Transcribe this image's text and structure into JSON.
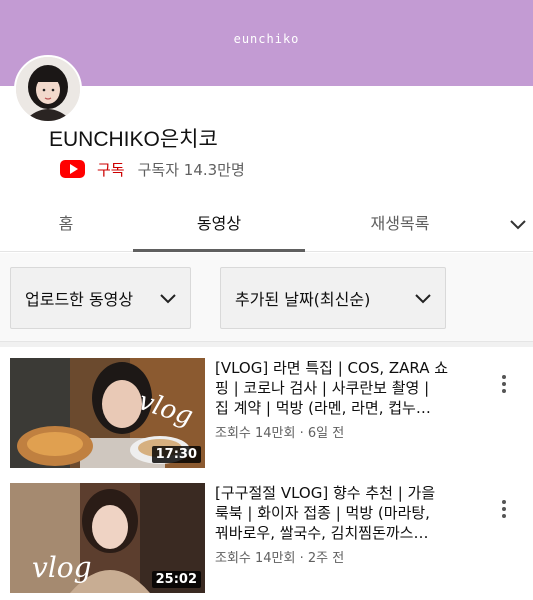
{
  "banner": {
    "text": "eunchiko",
    "color": "#c39bd3"
  },
  "channel": {
    "name": "EUNCHIKO은치코",
    "subscribe_label": "구독",
    "subscriber_count": "구독자 14.3만명"
  },
  "tabs": [
    {
      "label": "홈"
    },
    {
      "label": "동영상",
      "selected": true
    },
    {
      "label": "재생목록"
    }
  ],
  "filters": {
    "type_label": "업로드한 동영상",
    "sort_label": "추가된 날짜(최신순)"
  },
  "icons": {
    "more_tabs": "chevron-down-icon",
    "menu": "more-vert-icon",
    "brand": "youtube-logo-icon"
  },
  "videos": [
    {
      "title_lines": [
        "[VLOG] 라면 특집 | COS, ZARA 쇼",
        "핑 | 코로나 검사 | 사쿠란보 촬영 |",
        "집 계약 | 먹방 (라멘, 라면, 컵누…"
      ],
      "views_date": "조회수 14만회 · 6일 전",
      "duration": "17:30",
      "overlay_text": "vlog"
    },
    {
      "title_lines": [
        "[구구절절 VLOG] 향수 추천 | 가을",
        "룩북 | 화이자 접종 | 먹방 (마라탕,",
        "꿔바로우, 쌀국수, 김치찜돈까스…"
      ],
      "views_date": "조회수 14만회 · 2주 전",
      "duration": "25:02",
      "overlay_text": "vlog"
    }
  ]
}
